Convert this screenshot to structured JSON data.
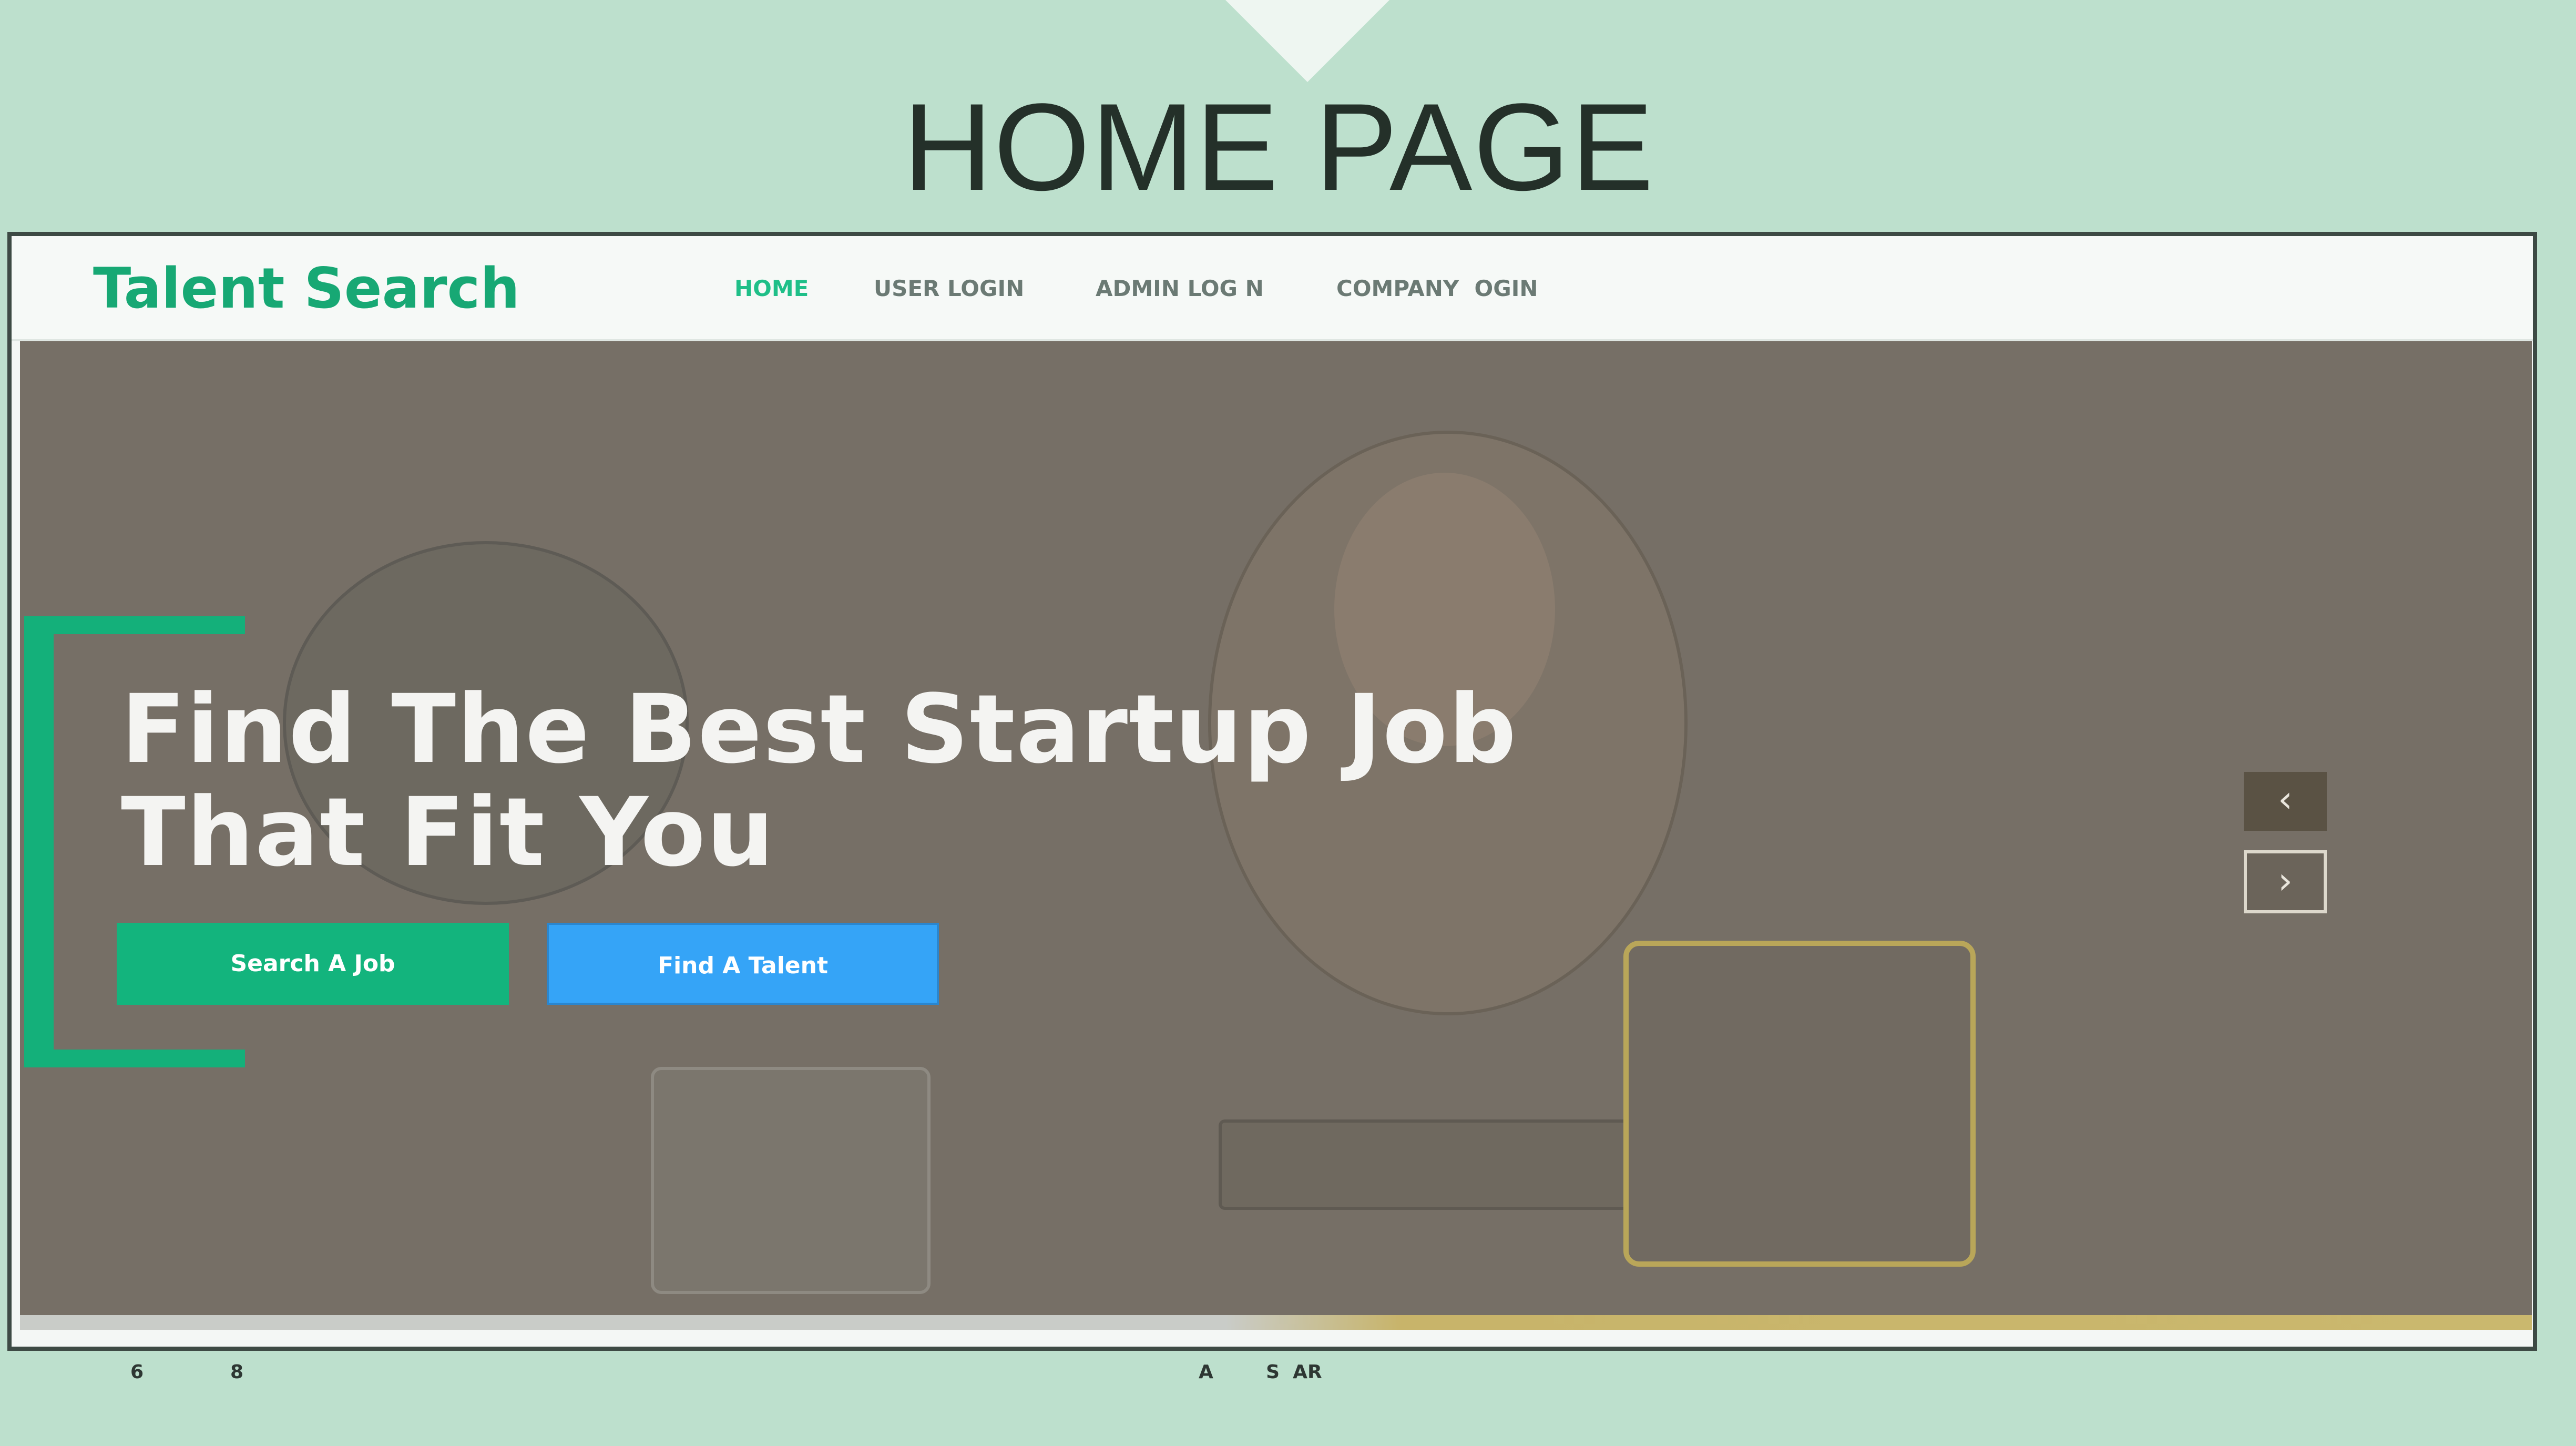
{
  "slide": {
    "title": "HOME PAGE"
  },
  "site": {
    "brand": "Talent Search",
    "nav": [
      {
        "label": "HOME",
        "active": true
      },
      {
        "label": "USER LOGIN",
        "active": false
      },
      {
        "label": "ADMIN LOG N",
        "active": false
      },
      {
        "label": "COMPANY  OGIN",
        "active": false
      }
    ]
  },
  "hero": {
    "headline_line1": "Find The Best Startup Job",
    "headline_line2": "That Fit You",
    "search_job_button": "Search A Job",
    "find_talent_button": "Find A Talent",
    "prev_icon": "chevron-left-icon",
    "next_icon": "chevron-right-icon",
    "prev_glyph": "‹",
    "next_glyph": "›"
  },
  "footer": {
    "left_a": "6",
    "left_b": "8",
    "center": "A        S  AR"
  },
  "colors": {
    "brand": "#17a874",
    "nav_active": "#1fbf88",
    "primary_button": "#13b47d",
    "secondary_button": "#35a4f7",
    "slide_background": "#bde0cd"
  }
}
